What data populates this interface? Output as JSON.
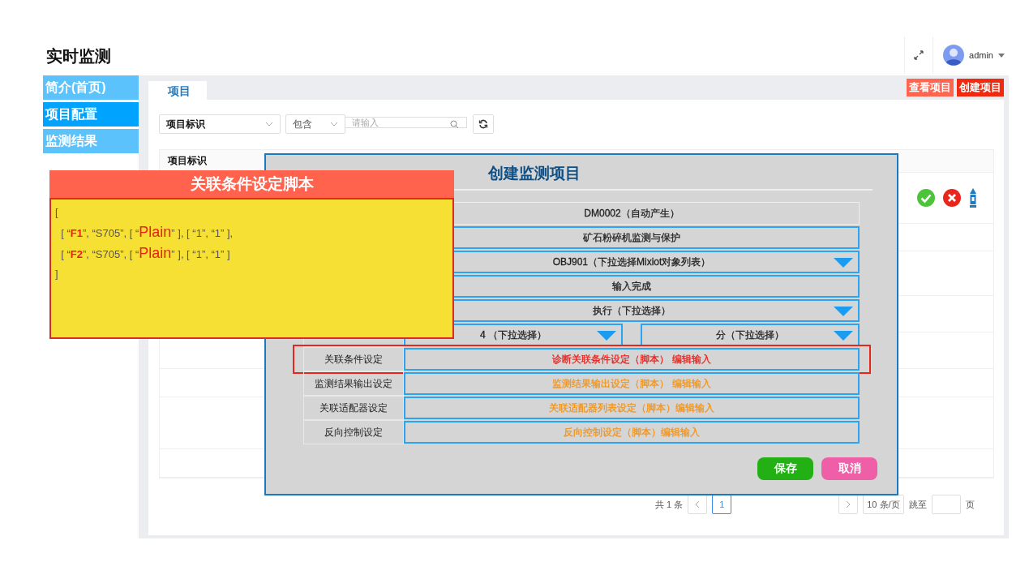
{
  "header": {
    "title": "实时监测",
    "user": "admin"
  },
  "sidebar": {
    "items": [
      {
        "label": "简介(首页)",
        "selected": false
      },
      {
        "label": "项目配置",
        "selected": true
      },
      {
        "label": "监测结果",
        "selected": false
      }
    ]
  },
  "tabs": [
    {
      "label": "项目",
      "selected": true
    }
  ],
  "actions": [
    {
      "label": "查看项目",
      "color": "#ff6550"
    },
    {
      "label": "创建项目",
      "color": "#f02a10"
    }
  ],
  "filter": {
    "field": "项目标识",
    "operator": "包含",
    "placeholder": "请输入"
  },
  "table": {
    "columns": [
      "项目标识"
    ]
  },
  "pagination": {
    "total": "共 1 条",
    "page": "1",
    "page_size": "10 条/页",
    "jump": "跳至",
    "page_unit": "页"
  },
  "modal": {
    "title": "创建监测项目",
    "rows": [
      {
        "kind": "static",
        "values": [
          {
            "text": "DM0002（自动产生）",
            "color": "#222222"
          }
        ]
      },
      {
        "kind": "field",
        "values": [
          {
            "text": "矿石粉碎机监测与保护",
            "color": "#222222"
          }
        ]
      },
      {
        "kind": "dropdown",
        "values": [
          {
            "text": "OBJ901（下拉选择Mixiot对象列表）",
            "color": "#222222"
          }
        ]
      },
      {
        "kind": "field",
        "values": [
          {
            "text": "输入完成",
            "color": "#222222"
          }
        ]
      },
      {
        "kind": "dropdown",
        "values": [
          {
            "text": "执行（下拉选择）",
            "color": "#222222"
          }
        ]
      },
      {
        "kind": "dropdown",
        "values": [
          {
            "text": "4 （下拉选择）",
            "color": "#222222"
          },
          {
            "text": "分（下拉选择）",
            "color": "#222222"
          }
        ]
      },
      {
        "kind": "field",
        "label": "关联条件设定",
        "highlighted": true,
        "values": [
          {
            "text": "诊断关联条件设定（脚本） 编辑输入",
            "color": "#e8201a"
          }
        ]
      },
      {
        "kind": "field",
        "label": "监测结果输出设定",
        "values": [
          {
            "text": "监测结果输出设定（脚本） 编辑输入",
            "color": "#f2941a"
          }
        ]
      },
      {
        "kind": "field",
        "label": "关联适配器设定",
        "values": [
          {
            "text": "关联适配器列表设定（脚本）编辑输入",
            "color": "#f2941a"
          }
        ]
      },
      {
        "kind": "field",
        "label": "反向控制设定",
        "values": [
          {
            "text": "反向控制设定（脚本）编辑输入",
            "color": "#f2941a"
          }
        ]
      }
    ],
    "buttons": [
      {
        "label": "保存",
        "kind": "primary"
      },
      {
        "label": "取消",
        "kind": "cancel"
      }
    ]
  },
  "script_popup": {
    "title": "关联条件设定脚本",
    "lines": [
      [
        {
          "text": "[",
          "kind": "plain"
        }
      ],
      [
        {
          "text": "  [ “",
          "kind": "plain"
        },
        {
          "text": "F1",
          "kind": "key"
        },
        {
          "text": "”, “S705”, [ “",
          "kind": "plain"
        },
        {
          "text": "Plain",
          "kind": "type"
        },
        {
          "text": "” ], [ “1”, “1” ],",
          "kind": "plain"
        }
      ],
      [
        {
          "text": "  [ “",
          "kind": "plain"
        },
        {
          "text": "F2",
          "kind": "key"
        },
        {
          "text": "”, “S705”, [ “",
          "kind": "plain"
        },
        {
          "text": "Plain",
          "kind": "type"
        },
        {
          "text": "” ], [ “1”, “1” ]",
          "kind": "plain"
        }
      ],
      [
        {
          "text": "]",
          "kind": "plain"
        }
      ]
    ]
  }
}
